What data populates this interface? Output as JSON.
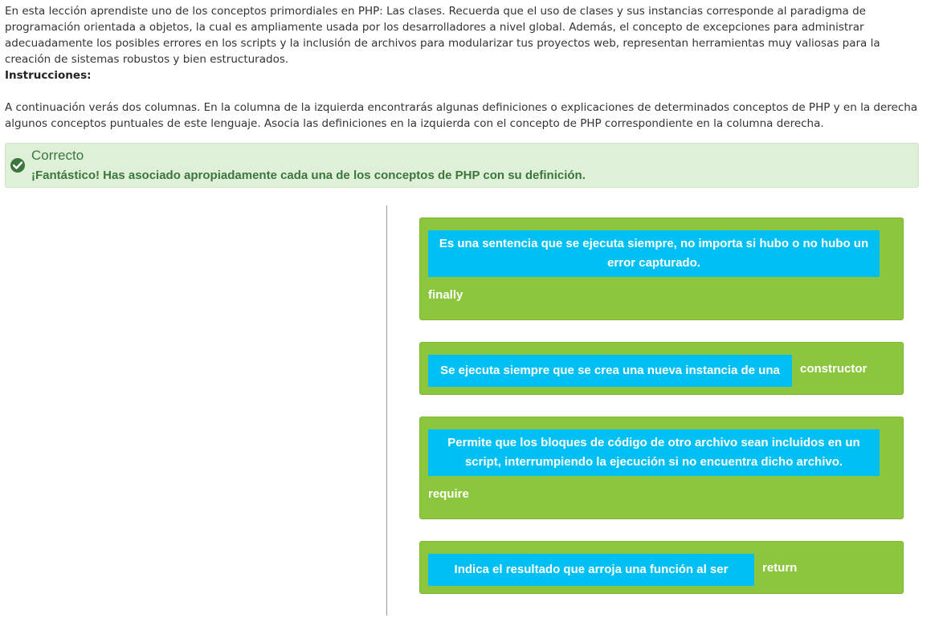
{
  "intro": {
    "paragraph": "En esta lección aprendiste uno de los conceptos primordiales en PHP: Las clases. Recuerda que el uso de clases y sus instancias corresponde al paradigma de programación orientada a objetos, la cual es ampliamente usada por los desarrolladores a nivel global. Además, el concepto de excepciones para administrar adecuadamente los posibles errores en los scripts y la inclusión de archivos para modularizar tus proyectos web, representan herramientas muy valiosas para la creación de sistemas robustos y bien estructurados.",
    "instructions_title": "Instrucciones:",
    "instructions_text": "A continuación verás dos columnas. En la columna de la izquierda encontrarás algunas definiciones o explicaciones de determinados conceptos de PHP y en la derecha algunos conceptos puntuales de este lenguaje. Asocia las definiciones en la izquierda con el concepto de PHP correspondiente en la columna derecha."
  },
  "feedback": {
    "title": "Correcto",
    "message": "¡Fantástico! Has asociado apropiadamente cada una de los conceptos de PHP con su definición.",
    "icon": "check-circle-icon"
  },
  "matches": [
    {
      "definition": "Es una sentencia que se ejecuta siempre, no importa si hubo o no hubo un error capturado.",
      "term": "finally"
    },
    {
      "definition": "Se ejecuta siempre que se crea una nueva instancia de una clase.",
      "term": "constructor"
    },
    {
      "definition": "Permite que los bloques de código de otro archivo sean incluidos en un script, interrumpiendo la ejecución si no encuentra dicho archivo.",
      "term": "require"
    },
    {
      "definition": "Indica el resultado que arroja una función al ser invocada.",
      "term": "return"
    }
  ],
  "colors": {
    "card_green": "#8cc63f",
    "definition_blue": "#00bff3",
    "success_bg": "#dff0d8",
    "success_text": "#3c763d"
  }
}
